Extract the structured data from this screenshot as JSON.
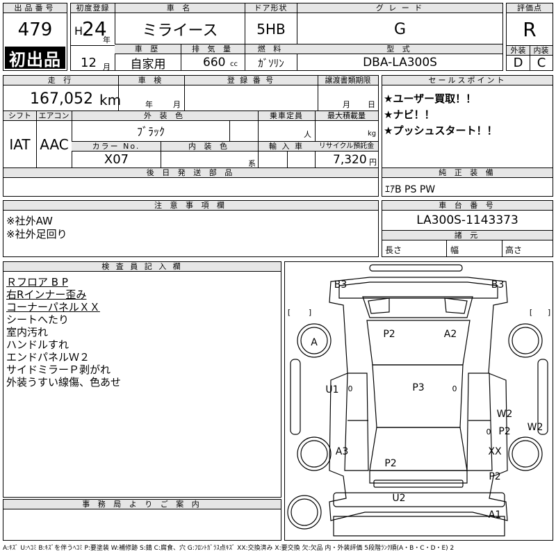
{
  "header": {
    "lot_no_label": "出品番号",
    "lot_no": "479",
    "first_listing_badge": "初出品",
    "first_reg_label": "初度登録",
    "era": "H",
    "year": "24",
    "year_unit": "年",
    "month": "12",
    "month_unit": "月",
    "car_name_label": "車 名",
    "car_name": "ミライース",
    "door_label": "ドア形状",
    "door": "5HB",
    "grade_label": "グ レ ー ド",
    "grade": "G",
    "eval_label": "評価点",
    "eval": "R",
    "history_label": "車 歴",
    "history": "自家用",
    "displacement_label": "排 気 量",
    "displacement": "660",
    "displacement_unit": "cc",
    "fuel_label": "燃 料",
    "fuel": "ｶﾞｿﾘﾝ",
    "model_label": "型 式",
    "model": "DBA-LA300S",
    "exterior_label": "外装",
    "exterior_grade": "D",
    "interior_label": "内装",
    "interior_grade": "C"
  },
  "mid": {
    "mileage_label": "走 行",
    "mileage": "167,052",
    "mileage_unit": "km",
    "inspection_label": "車 検",
    "insp_year_unit": "年",
    "insp_month_unit": "月",
    "reg_no_label": "登 録 番 号",
    "transfer_label": "譲渡書類期限",
    "transfer_month_unit": "月",
    "transfer_day_unit": "日",
    "shift_label": "シフト",
    "shift": "IAT",
    "ac_label": "エアコン",
    "ac": "AAC",
    "color_label": "外 装 色",
    "color": "ﾌﾞﾗｯｸ",
    "capacity_label": "乗車定員",
    "capacity_unit": "人",
    "load_label": "最大積載量",
    "load_unit": "kg",
    "color_no_label": "カラー No.",
    "color_no": "X07",
    "interior_color_label": "内 装 色",
    "interior_color_unit": "系",
    "import_label": "輸 入 車",
    "recycle_label": "リサイクル預託金",
    "recycle": "7,320",
    "recycle_unit": "円"
  },
  "sales": {
    "label": "セールスポイント",
    "points": [
      "★ユーザー買取！！",
      "★ナビ！！",
      "★プッシュスタート！！"
    ]
  },
  "later_parts": {
    "label": "後 日 発 送 部 品",
    "value": ""
  },
  "equipment": {
    "label": "純 正 装 備",
    "value": "ｴｱB PS PW"
  },
  "notes": {
    "label": "注 意 事 項 欄",
    "items": [
      "※社外AW",
      "※社外足回り"
    ]
  },
  "chassis": {
    "label": "車 台 番 号",
    "value": "LA300S-1143373",
    "dims_label": "諸 元",
    "length_label": "長さ",
    "width_label": "幅",
    "height_label": "高さ"
  },
  "inspector": {
    "label": "検 査 員 記 入 欄",
    "items": [
      "Ｒフロア B P",
      "右Rインナー歪み",
      "コーナーパネルＸＸ",
      "シートへたり",
      "室内汚れ",
      "ハンドルすれ",
      "エンドパネルＷ２",
      "サイドミラーＰ剥がれ",
      "外装うすい線傷、色あせ"
    ]
  },
  "diagram": {
    "marks": {
      "b3_left": "B3",
      "b3_right": "B3",
      "p2_top": "P2",
      "a2": "A2",
      "a_wheel": "A",
      "u1": "U1",
      "p3": "P3",
      "w2_inner": "W2",
      "w2_outer": "W2",
      "p2_right": "P2",
      "a3": "A3",
      "xx": "XX",
      "p2_rear": "P2",
      "p2_right_rear": "P2",
      "u2": "U2",
      "a1": "A1",
      "zero_left": "0",
      "zero_right": "0",
      "zero_p2": "0"
    },
    "bracket_left_open": "[",
    "bracket_left_close": "]",
    "bracket_right_open": "[",
    "bracket_right_close": "]"
  },
  "office": {
    "label": "事 務 局 よ り ご 案 内",
    "value": ""
  },
  "legend": "A:ｷｽﾞ U:ﾍｺﾐ B:ｷｽﾞを伴うﾍｺﾐ P:要塗装 W:補修跡 S:錆 C:腐食、穴 G:ﾌﾛﾝﾄｶﾞﾗｽ点ｷｽﾞ XX:交換済み X:要交換 欠:欠品 内・外装評価 5段階ﾗﾝｸ順(A・B・C・D・E) 2"
}
